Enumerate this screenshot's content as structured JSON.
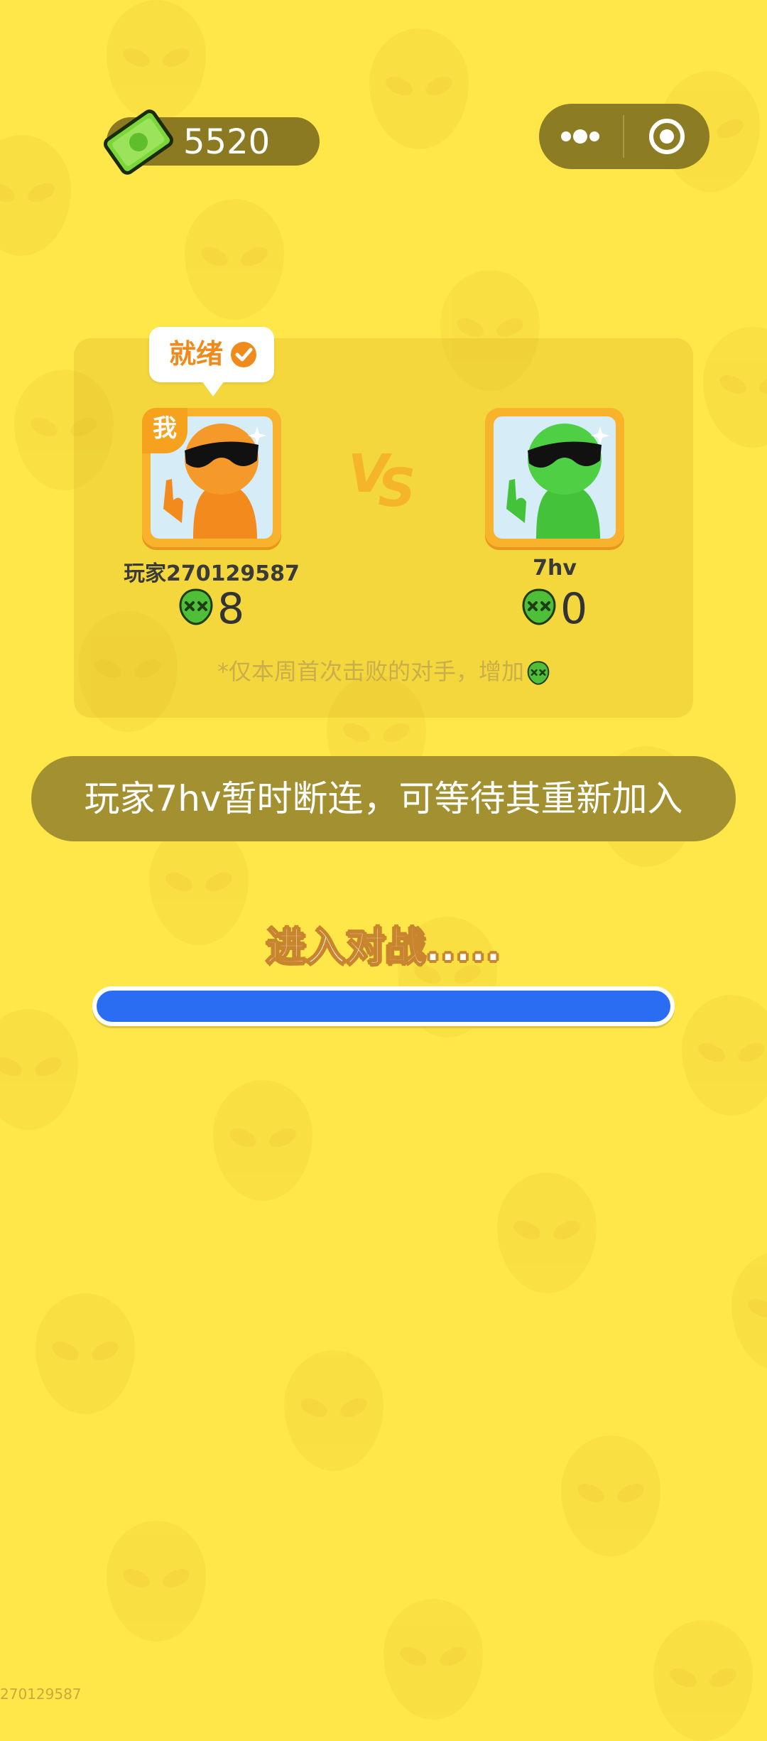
{
  "currency": {
    "icon": "cash-icon",
    "amount": "5520"
  },
  "menu": {
    "more_icon": "more-dots-icon",
    "close_icon": "target-icon"
  },
  "match": {
    "ready_label": "就绪",
    "me_badge": "我",
    "vs_icon": "vs-icon",
    "player_left": {
      "name": "玩家270129587",
      "score": "8",
      "avatar": "orange-alien-avatar"
    },
    "player_right": {
      "name": "7hv",
      "score": "0",
      "avatar": "green-alien-avatar"
    },
    "note": "*仅本周首次击败的对手，增加"
  },
  "banner": {
    "text": "玩家7hv暂时断连，可等待其重新加入"
  },
  "loading": {
    "label": "进入对战.....",
    "progress": 1.0
  },
  "footer": {
    "uid": "270129587"
  },
  "colors": {
    "background": "#FFE74A",
    "progress": "#2B6DF2",
    "ready": "#F08A1C"
  }
}
